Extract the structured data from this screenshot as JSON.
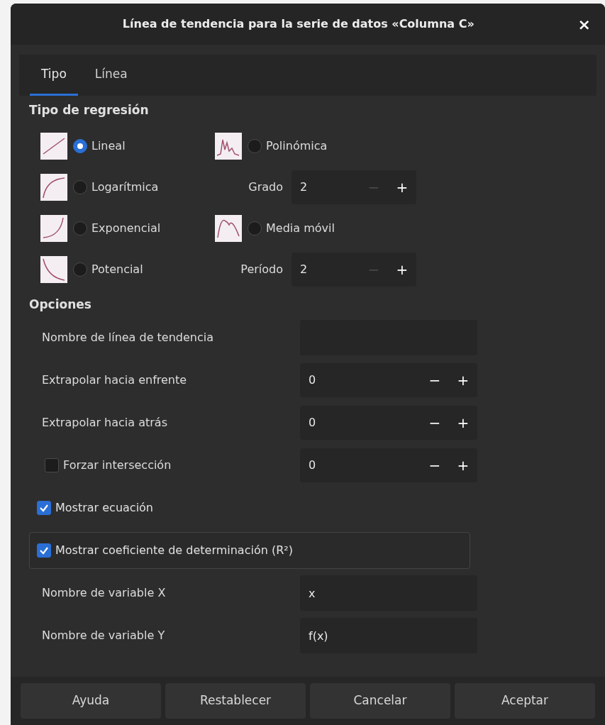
{
  "window": {
    "title": "Línea de tendencia para la serie de datos «Columna C»",
    "close": "×"
  },
  "tabs": [
    {
      "label": "Tipo",
      "selected": true
    },
    {
      "label": "Línea",
      "selected": false
    }
  ],
  "regression": {
    "heading": "Tipo de regresión",
    "rows": [
      [
        {
          "kind": "linear",
          "label": "Lineal",
          "selected": true
        },
        {
          "kind": "polynomial",
          "label": "Polinómica",
          "selected": false
        }
      ],
      [
        {
          "kind": "logarithmic",
          "label": "Logarítmica",
          "selected": false
        },
        {
          "kind": "spin",
          "label": "Grado",
          "value": "2",
          "minus": "−",
          "plus": "+",
          "minus_disabled": true
        }
      ],
      [
        {
          "kind": "exponential",
          "label": "Exponencial",
          "selected": false
        },
        {
          "kind": "moving",
          "label": "Media móvil",
          "selected": false
        }
      ],
      [
        {
          "kind": "power",
          "label": "Potencial",
          "selected": false
        },
        {
          "kind": "spin",
          "label": "Período",
          "value": "2",
          "minus": "−",
          "plus": "+",
          "minus_disabled": true
        }
      ]
    ]
  },
  "options": {
    "heading": "Opciones",
    "rows": [
      {
        "kind": "field",
        "label": "Nombre de línea de tendencia"
      },
      {
        "kind": "spin",
        "label": "Extrapolar hacia enfrente",
        "value": "0",
        "minus": "−",
        "plus": "+",
        "minus_disabled": false
      },
      {
        "kind": "spin",
        "label": "Extrapolar hacia atrás",
        "value": "0",
        "minus": "−",
        "plus": "+",
        "minus_disabled": false
      },
      {
        "kind": "check_spin",
        "label": "Forzar intersección",
        "checked": false,
        "value": "0",
        "minus": "−",
        "plus": "+",
        "minus_disabled": false
      },
      {
        "kind": "check",
        "label": "Mostrar ecuación",
        "checked": true,
        "focused": false
      },
      {
        "kind": "check",
        "label": "Mostrar coeficiente de determinación (R²)",
        "checked": true,
        "focused": true
      },
      {
        "kind": "field",
        "label": "Nombre de variable X",
        "value": "x"
      },
      {
        "kind": "field",
        "label": "Nombre de variable Y",
        "value": "f(x)"
      }
    ]
  },
  "buttons": [
    "Ayuda",
    "Restablecer",
    "Cancelar",
    "Aceptar"
  ]
}
